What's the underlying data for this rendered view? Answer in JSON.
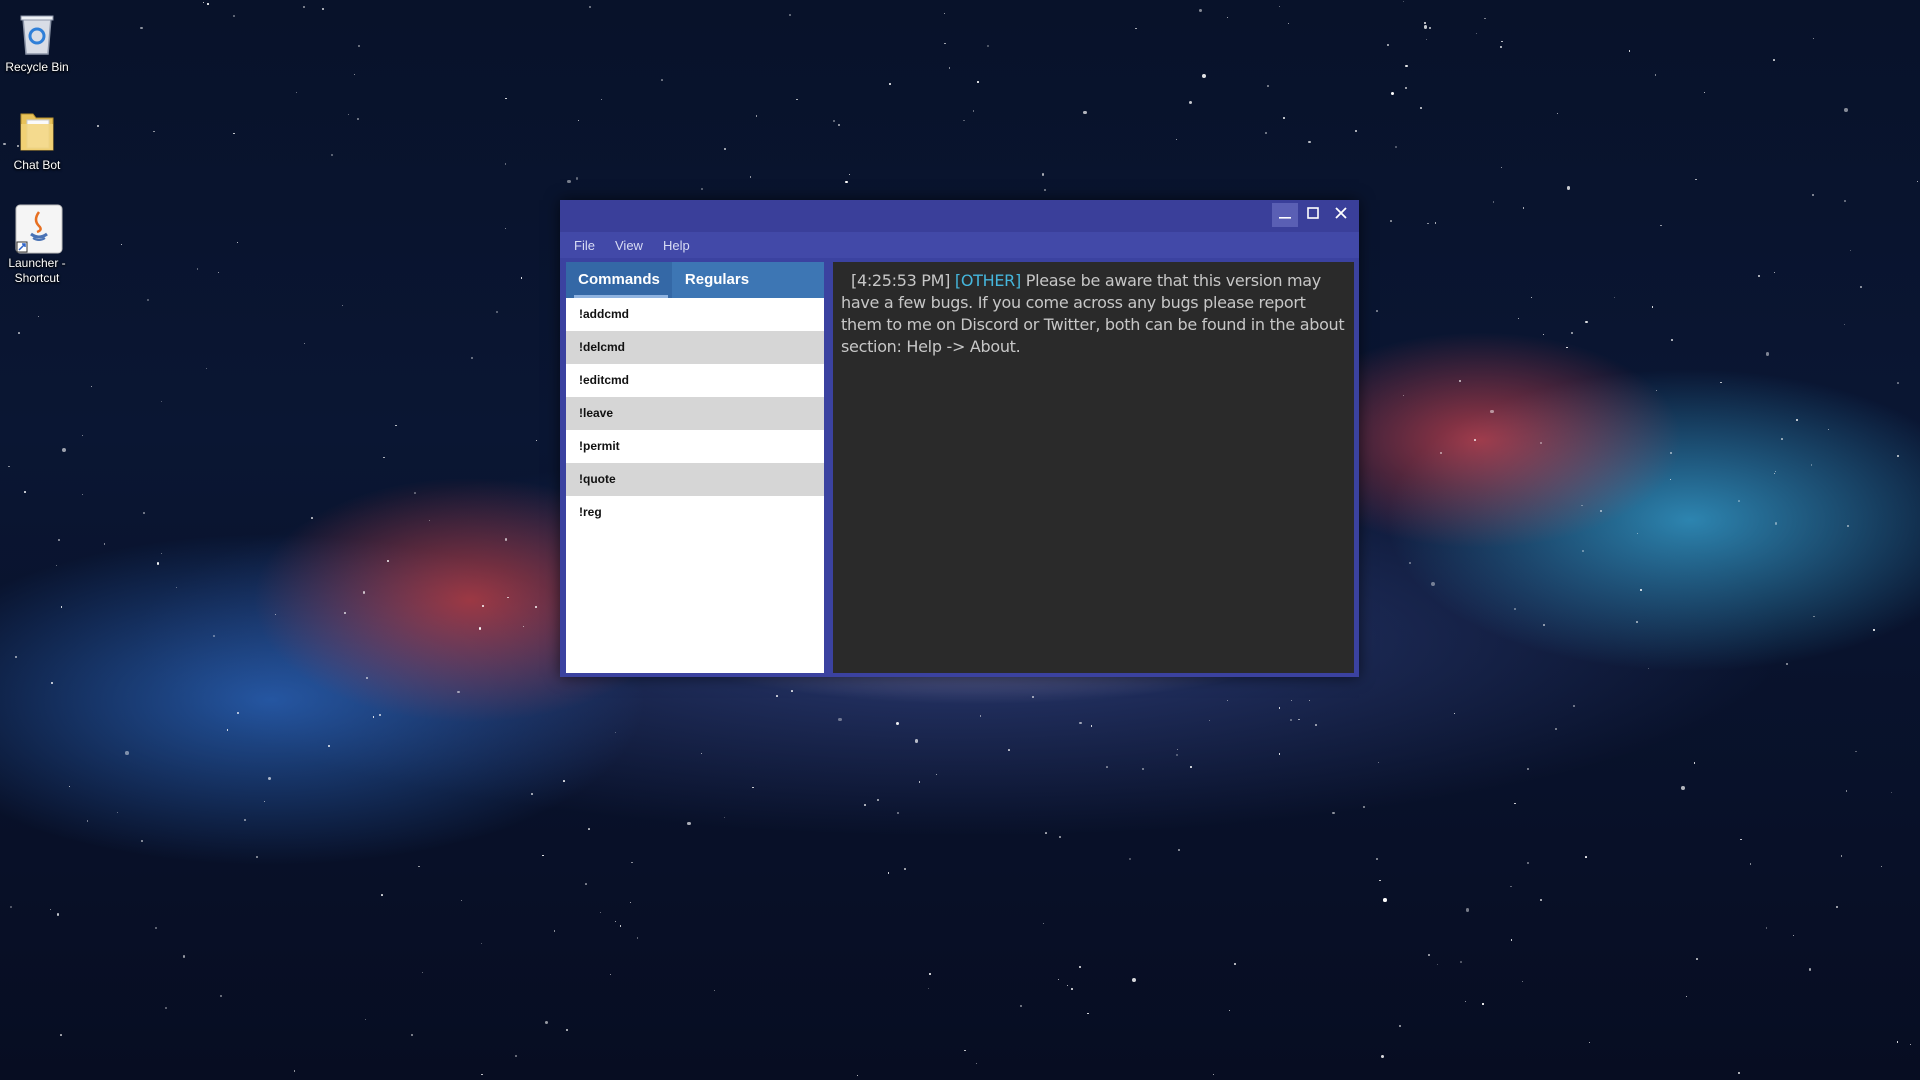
{
  "desktop": {
    "icons": [
      {
        "label": "Recycle Bin",
        "icon": "recycle-bin-icon"
      },
      {
        "label": "Chat Bot",
        "icon": "folder-icon"
      },
      {
        "label": "Launcher - Shortcut",
        "icon": "java-icon"
      }
    ]
  },
  "window": {
    "controls": {
      "minimize": "minimize-icon",
      "maximize": "maximize-icon",
      "close": "close-icon"
    },
    "menu": [
      "File",
      "View",
      "Help"
    ],
    "tabs": [
      {
        "label": "Commands",
        "active": true
      },
      {
        "label": "Regulars",
        "active": false
      }
    ],
    "commands": [
      "!addcmd",
      "!delcmd",
      "!editcmd",
      "!leave",
      "!permit",
      "!quote",
      "!reg"
    ],
    "chat": {
      "timestamp": "[4:25:53 PM]",
      "tag": "[OTHER]",
      "message": "Please be aware that this version may have a few bugs. If you come across any bugs please report them to me on Discord or Twitter, both can be found in the about section: Help -> About."
    }
  },
  "colors": {
    "titlebar": "#3a3f9a",
    "menubar": "#4249a8",
    "tab_bar": "#3d76b4",
    "chat_bg": "#2a2a2a",
    "chat_tag": "#45b6dc"
  }
}
